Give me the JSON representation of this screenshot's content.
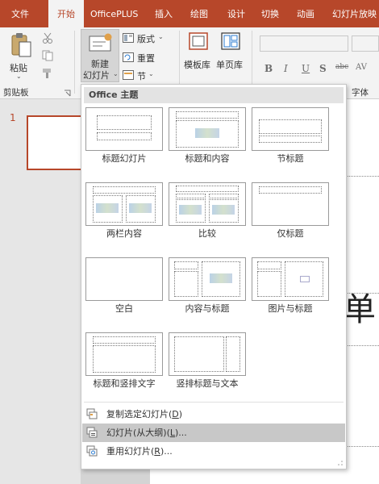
{
  "tabs": [
    {
      "label": "文件"
    },
    {
      "label": "开始"
    },
    {
      "label": "OfficePLUS"
    },
    {
      "label": "插入"
    },
    {
      "label": "绘图"
    },
    {
      "label": "设计"
    },
    {
      "label": "切换"
    },
    {
      "label": "动画"
    },
    {
      "label": "幻灯片放映"
    }
  ],
  "ribbon": {
    "paste_label": "粘贴",
    "clipboard_group": "剪贴板",
    "new_slide_line1": "新建",
    "new_slide_line2": "幻灯片",
    "layout_label": "版式",
    "reset_label": "重置",
    "section_label": "节",
    "template_lib_label": "模板库",
    "single_page_label": "单页库",
    "font_group": "字体",
    "format_buttons": [
      "B",
      "I",
      "U",
      "S",
      "abc",
      "AV"
    ]
  },
  "slide_pane": {
    "slide_number": "1"
  },
  "canvas": {
    "title_fragment": "单"
  },
  "dropdown": {
    "header": "Office 主题",
    "layouts": [
      {
        "name": "标题幻灯片"
      },
      {
        "name": "标题和内容"
      },
      {
        "name": "节标题"
      },
      {
        "name": "两栏内容"
      },
      {
        "name": "比较"
      },
      {
        "name": "仅标题"
      },
      {
        "name": "空白"
      },
      {
        "name": "内容与标题"
      },
      {
        "name": "图片与标题"
      },
      {
        "name": "标题和竖排文字"
      },
      {
        "name": "竖排标题与文本"
      }
    ],
    "menu": [
      {
        "prefix": "复制选定幻灯片(",
        "key": "D",
        "suffix": ")"
      },
      {
        "prefix": "幻灯片(从大纲)(",
        "key": "L",
        "suffix": ")..."
      },
      {
        "prefix": "重用幻灯片(",
        "key": "R",
        "suffix": ")..."
      }
    ]
  },
  "colors": {
    "accent": "#b7472a",
    "ribbon_bg": "#f3f3f3",
    "hover": "#c8c8c8"
  }
}
